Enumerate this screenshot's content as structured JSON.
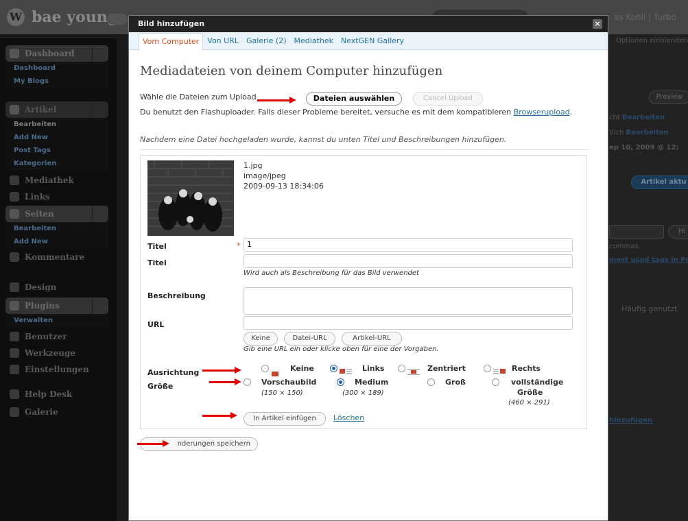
{
  "background": {
    "site_title": "bae young",
    "user_text": "as Kohli | Turbo",
    "sidebar": [
      {
        "label": "Dashboard",
        "subs": [
          "Dashboard",
          "My Blogs"
        ]
      },
      {
        "label": "Artikel",
        "subs": [
          "Bearbeiten",
          "Add New",
          "Post Tags",
          "Kategorien"
        ]
      },
      {
        "label": "Mediathek"
      },
      {
        "label": "Links"
      },
      {
        "label": "Seiten",
        "subs": [
          "Bearbeiten",
          "Add New"
        ]
      },
      {
        "label": "Kommentare"
      },
      {
        "label": "Design"
      },
      {
        "label": "Plugins",
        "subs": [
          "Verwalten"
        ]
      },
      {
        "label": "Benutzer"
      },
      {
        "label": "Werkzeuge"
      },
      {
        "label": "Einstellungen"
      },
      {
        "label": "Help Desk"
      },
      {
        "label": "Galerie"
      }
    ],
    "right": {
      "options": "Optionen einblenden",
      "preview": "Preview",
      "bearbeiten1_pre": "cht",
      "bearbeiten1": "Bearbeiten",
      "bearbeiten2_pre": "tlich",
      "bearbeiten2": "Bearbeiten",
      "date": "ep 10, 2009 @ 12:",
      "update": "Artikel aktu",
      "hi": "Hi",
      "commas": "commas.",
      "most_used": "most used tags in Po",
      "haeufig": "Häufig genutzt",
      "hinzufuegen": "hinzufügen"
    }
  },
  "dialog": {
    "title": "Bild hinzufügen",
    "close": "×",
    "tabs": [
      "Vom Computer",
      "Von URL",
      "Galerie (2)",
      "Mediathek",
      "NextGEN Gallery"
    ],
    "heading": "Mediadateien von deinem Computer hinzufügen",
    "upload_prompt": "Wähle die Dateien zum Upload",
    "select_files": "Dateien auswählen",
    "cancel_upload": "Cancel Upload",
    "info_text": "Du benutzt den Flashuploader. Falls dieser Probleme bereitet, versuche es mit dem kompatibleren",
    "info_link": "Browserupload",
    "info_end": ".",
    "note": "Nachdem eine Datei hochgeladen wurde, kannst du unten Titel und Beschreibungen hinzufügen.",
    "file": {
      "name": "1.jpg",
      "type": "image/jpeg",
      "date": "2009-09-13 18:34:06"
    },
    "fields": {
      "title_label": "Titel",
      "title_required": "*",
      "title_value": "1",
      "caption_label": "Titel",
      "caption_value": "",
      "caption_help": "Wird auch als Beschreibung für das Bild verwendet",
      "description_label": "Beschreibung",
      "url_label": "URL",
      "url_value": "",
      "url_buttons": [
        "Keine",
        "Datei-URL",
        "Artikel-URL"
      ],
      "url_help": "Gib eine URL ein oder klicke oben für eine der Vorgaben.",
      "alignment_label": "Ausrichtung",
      "alignment_options": [
        {
          "label": "Keine",
          "checked": false
        },
        {
          "label": "Links",
          "checked": true
        },
        {
          "label": "Zentriert",
          "checked": false
        },
        {
          "label": "Rechts",
          "checked": false
        }
      ],
      "size_label": "Größe",
      "size_options": [
        {
          "label": "Vorschaubild",
          "dims": "(150 × 150)",
          "checked": false
        },
        {
          "label": "Medium",
          "dims": "(300 × 189)",
          "checked": true
        },
        {
          "label": "Groß",
          "dims": "",
          "checked": false
        },
        {
          "label": "vollständige Größe",
          "label1": "vollständige",
          "label2": "Größe",
          "dims": "(460 × 291)",
          "checked": false
        }
      ],
      "insert_button": "In Artikel einfügen",
      "delete_link": "Löschen"
    },
    "save_all": "Alle Änderungen speichern",
    "save_all_visible": "nderungen speichern"
  },
  "colors": {
    "accent": "#21759b",
    "active_tab": "#d54e21",
    "arrow": "#e20000"
  }
}
